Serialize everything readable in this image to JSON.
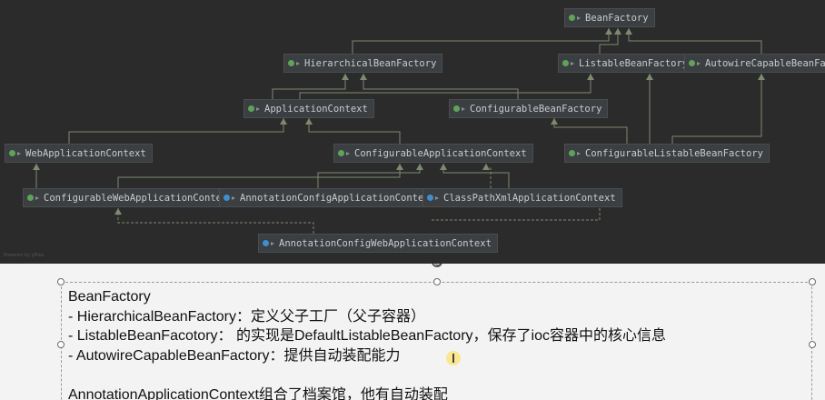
{
  "diagram": {
    "footer": "Powered by yFiles",
    "nodes": [
      {
        "id": "bf",
        "label": "BeanFactory",
        "kind": "interface"
      },
      {
        "id": "hbf",
        "label": "HierarchicalBeanFactory",
        "kind": "interface"
      },
      {
        "id": "lbf",
        "label": "ListableBeanFactory",
        "kind": "interface"
      },
      {
        "id": "acbf",
        "label": "AutowireCapableBeanFactory",
        "kind": "interface"
      },
      {
        "id": "ac",
        "label": "ApplicationContext",
        "kind": "interface"
      },
      {
        "id": "cbf",
        "label": "ConfigurableBeanFactory",
        "kind": "interface"
      },
      {
        "id": "wac",
        "label": "WebApplicationContext",
        "kind": "interface"
      },
      {
        "id": "cac",
        "label": "ConfigurableApplicationContext",
        "kind": "interface"
      },
      {
        "id": "clbf",
        "label": "ConfigurableListableBeanFactory",
        "kind": "interface"
      },
      {
        "id": "cwac",
        "label": "ConfigurableWebApplicationContext",
        "kind": "interface"
      },
      {
        "id": "annoac",
        "label": "AnnotationConfigApplicationContext",
        "kind": "class"
      },
      {
        "id": "cpxac",
        "label": "ClassPathXmlApplicationContext",
        "kind": "class"
      },
      {
        "id": "annowac",
        "label": "AnnotationConfigWebApplicationContext",
        "kind": "class"
      }
    ]
  },
  "slide": {
    "lines": [
      "BeanFactory",
      "- HierarchicalBeanFactory：定义父子工厂（父子容器）",
      "- ListableBeanFacotory：  的实现是DefaultListableBeanFactory，保存了ioc容器中的核心信息",
      "- AutowireCapableBeanFactory：提供自动装配能力",
      "",
      "AnnotationApplicationContext组合了档案馆，他有自动装配"
    ]
  }
}
